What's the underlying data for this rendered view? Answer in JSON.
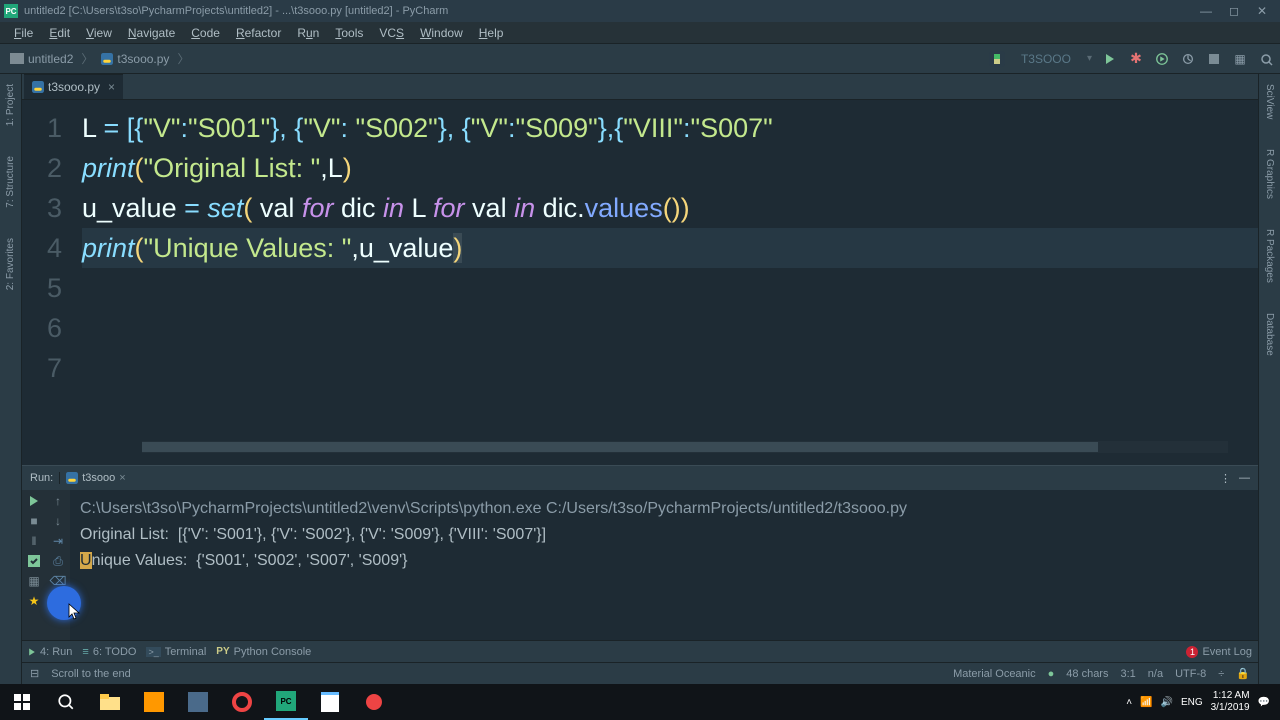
{
  "title": "untitled2 [C:\\Users\\t3so\\PycharmProjects\\untitled2] - ...\\t3sooo.py [untitled2] - PyCharm",
  "menu": [
    "File",
    "Edit",
    "View",
    "Navigate",
    "Code",
    "Refactor",
    "Run",
    "Tools",
    "VCS",
    "Window",
    "Help"
  ],
  "breadcrumb": {
    "project": "untitled2",
    "file": "t3sooo.py"
  },
  "run_config": "T3SOOO",
  "file_tab": "t3sooo.py",
  "gutter": [
    "1",
    "2",
    "3",
    "4",
    "5",
    "6",
    "7"
  ],
  "code": {
    "l1_a": "L ",
    "l1_eq": "= ",
    "l1_b": "[{",
    "l1_s1": "\"V\"",
    "l1_c": ":",
    "l1_s2": "\"S001\"",
    "l1_d": "}, {",
    "l1_s3": "\"V\"",
    "l1_e": ": ",
    "l1_s4": "\"S002\"",
    "l1_f": "}, {",
    "l1_s5": "\"V\"",
    "l1_g": ":",
    "l1_s6": "\"S009\"",
    "l1_h": "},{",
    "l1_s7": "\"VIII\"",
    "l1_i": ":",
    "l1_s8": "\"S007\"",
    "l2_fn": "print",
    "l2_p": "(",
    "l2_s": "\"Original List: \"",
    "l2_c": ",L",
    "l2_pe": ")",
    "l3_a": "u_value ",
    "l3_eq": "= ",
    "l3_set": "set",
    "l3_p": "( ",
    "l3_v": "val ",
    "l3_for": "for ",
    "l3_d": "dic ",
    "l3_in": "in ",
    "l3_L": "L ",
    "l3_for2": "for ",
    "l3_v2": "val ",
    "l3_in2": "in ",
    "l3_dc": "dic.",
    "l3_vals": "values",
    "l3_pe": "())",
    "l4_fn": "print",
    "l4_p": "(",
    "l4_s": "\"Unique Values: \"",
    "l4_c": ",u_value",
    "l4_pe": ")"
  },
  "run_panel": {
    "label": "Run:",
    "tab": "t3sooo"
  },
  "console": {
    "cmd": "C:\\Users\\t3so\\PycharmProjects\\untitled2\\venv\\Scripts\\python.exe C:/Users/t3so/PycharmProjects/untitled2/t3sooo.py",
    "out1": "Original List:  [{'V': 'S001'}, {'V': 'S002'}, {'V': 'S009'}, {'VIII': 'S007'}]",
    "out2": "Unique Values:  {'S001', 'S002', 'S007', 'S009'}"
  },
  "bottom_tabs": {
    "run": "4: Run",
    "todo": "6: TODO",
    "terminal": "Terminal",
    "pyconsole": "Python Console",
    "eventlog": "Event Log"
  },
  "status": {
    "scroll": "Scroll to the end",
    "theme": "Material Oceanic",
    "chars": "48 chars",
    "pos": "3:1",
    "na": "n/a",
    "enc": "UTF-8"
  },
  "tray": {
    "lang": "ENG",
    "time": "1:12 AM",
    "date": "3/1/2019"
  },
  "left_rail": [
    "1: Project",
    "7: Structure",
    "2: Favorites"
  ],
  "right_rail": [
    "SciView",
    "R Graphics",
    "R Packages",
    "Database"
  ]
}
